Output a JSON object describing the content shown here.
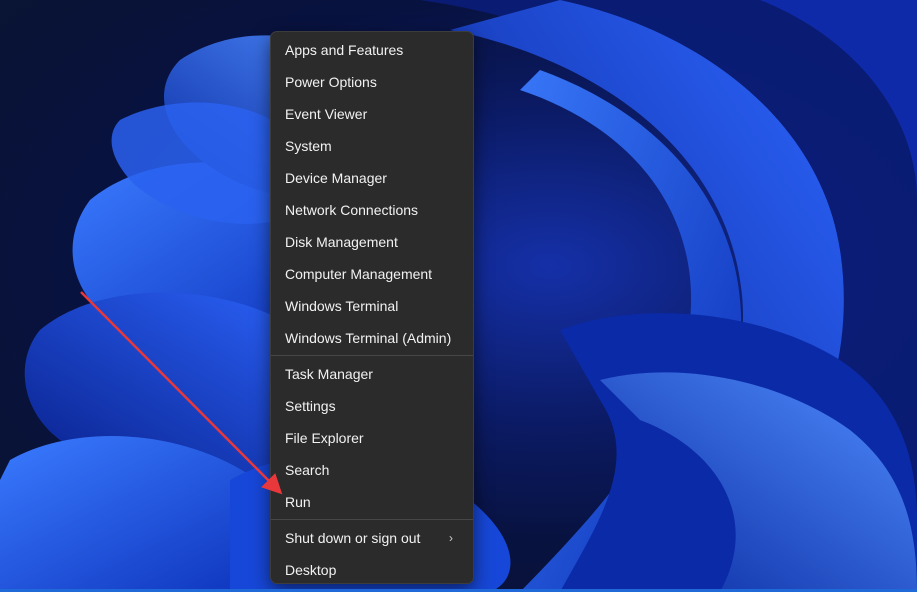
{
  "context_menu": {
    "group1": [
      {
        "label": "Apps and Features"
      },
      {
        "label": "Power Options"
      },
      {
        "label": "Event Viewer"
      },
      {
        "label": "System"
      },
      {
        "label": "Device Manager"
      },
      {
        "label": "Network Connections"
      },
      {
        "label": "Disk Management"
      },
      {
        "label": "Computer Management"
      },
      {
        "label": "Windows Terminal"
      },
      {
        "label": "Windows Terminal (Admin)"
      }
    ],
    "group2": [
      {
        "label": "Task Manager"
      },
      {
        "label": "Settings"
      },
      {
        "label": "File Explorer"
      },
      {
        "label": "Search"
      },
      {
        "label": "Run"
      }
    ],
    "group3": [
      {
        "label": "Shut down or sign out",
        "submenu_icon": "chevron-right-icon"
      },
      {
        "label": "Desktop"
      }
    ]
  },
  "annotation": {
    "type": "arrow",
    "color": "#e8383b",
    "points_to": "Run"
  },
  "colors": {
    "menu_background": "#2b2b2b",
    "menu_text": "#f2f2f2",
    "wallpaper_accent": "#1f5cf0"
  }
}
